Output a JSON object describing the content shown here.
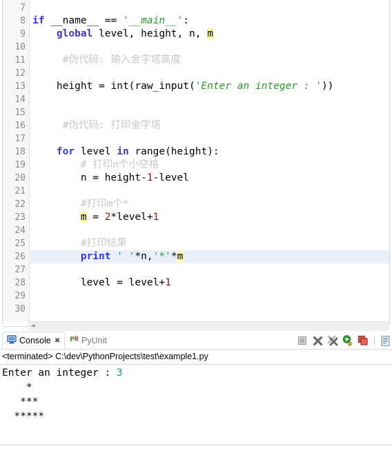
{
  "editor": {
    "name": "python-code-editor",
    "first_line_number": 7,
    "last_line_number": 30,
    "current_line": 26,
    "occurrence_token": "m",
    "lines": [
      {
        "n": 7,
        "segments": []
      },
      {
        "n": 8,
        "segments": [
          {
            "t": "if ",
            "c": "kw"
          },
          {
            "t": "__name__ == ",
            "c": "plain"
          },
          {
            "t": "'__main__'",
            "c": "str"
          },
          {
            "t": ":",
            "c": "plain"
          }
        ]
      },
      {
        "n": 9,
        "segments": [
          {
            "t": "    ",
            "c": "plain"
          },
          {
            "t": "global",
            "c": "kw"
          },
          {
            "t": " level, height, n, ",
            "c": "plain"
          },
          {
            "t": "m",
            "c": "occ"
          }
        ]
      },
      {
        "n": 10,
        "segments": []
      },
      {
        "n": 11,
        "segments": [
          {
            "t": "     ",
            "c": "plain"
          },
          {
            "t": "#伪代码: 输入金字塔高度",
            "c": "cmt"
          }
        ]
      },
      {
        "n": 12,
        "segments": []
      },
      {
        "n": 13,
        "segments": [
          {
            "t": "    height = int(raw_input(",
            "c": "plain"
          },
          {
            "t": "'Enter an integer : '",
            "c": "str"
          },
          {
            "t": "))",
            "c": "plain"
          }
        ]
      },
      {
        "n": 14,
        "segments": []
      },
      {
        "n": 15,
        "segments": []
      },
      {
        "n": 16,
        "segments": [
          {
            "t": "     ",
            "c": "plain"
          },
          {
            "t": "#伪代码: 打印金字塔",
            "c": "cmt"
          }
        ]
      },
      {
        "n": 17,
        "segments": []
      },
      {
        "n": 18,
        "segments": [
          {
            "t": "    ",
            "c": "plain"
          },
          {
            "t": "for",
            "c": "kw"
          },
          {
            "t": " level ",
            "c": "plain"
          },
          {
            "t": "in",
            "c": "kw"
          },
          {
            "t": " range(height):",
            "c": "plain"
          }
        ]
      },
      {
        "n": 19,
        "segments": [
          {
            "t": "        ",
            "c": "plain"
          },
          {
            "t": "# 打印n个小空格",
            "c": "cmt"
          }
        ]
      },
      {
        "n": 20,
        "segments": [
          {
            "t": "        n = height-",
            "c": "plain"
          },
          {
            "t": "1",
            "c": "num"
          },
          {
            "t": "-level",
            "c": "plain"
          }
        ]
      },
      {
        "n": 21,
        "segments": []
      },
      {
        "n": 22,
        "segments": [
          {
            "t": "        ",
            "c": "plain"
          },
          {
            "t": "#打印m个*",
            "c": "cmt"
          }
        ]
      },
      {
        "n": 23,
        "segments": [
          {
            "t": "        ",
            "c": "plain"
          },
          {
            "t": "m",
            "c": "occ"
          },
          {
            "t": " = ",
            "c": "plain"
          },
          {
            "t": "2",
            "c": "num"
          },
          {
            "t": "*level+",
            "c": "plain"
          },
          {
            "t": "1",
            "c": "num"
          }
        ]
      },
      {
        "n": 24,
        "segments": []
      },
      {
        "n": 25,
        "segments": [
          {
            "t": "        ",
            "c": "plain"
          },
          {
            "t": "#打印结果",
            "c": "cmt"
          }
        ]
      },
      {
        "n": 26,
        "segments": [
          {
            "t": "        ",
            "c": "plain"
          },
          {
            "t": "print",
            "c": "kw"
          },
          {
            "t": " ",
            "c": "plain"
          },
          {
            "t": "' '",
            "c": "strp"
          },
          {
            "t": "*n,",
            "c": "plain"
          },
          {
            "t": "'*'",
            "c": "strp"
          },
          {
            "t": "*",
            "c": "plain"
          },
          {
            "t": "m",
            "c": "occ"
          }
        ]
      },
      {
        "n": 27,
        "segments": []
      },
      {
        "n": 28,
        "segments": [
          {
            "t": "        level = level+",
            "c": "plain"
          },
          {
            "t": "1",
            "c": "num"
          }
        ]
      },
      {
        "n": 29,
        "segments": []
      },
      {
        "n": 30,
        "segments": []
      }
    ],
    "hscroll_left_arrow": "◄"
  },
  "console": {
    "tabs": [
      {
        "label": "Console",
        "icon": "console-monitor-icon",
        "active": true,
        "closeable": true
      },
      {
        "label": "PyUnit",
        "icon": "pyunit-icon",
        "active": false,
        "closeable": false
      }
    ],
    "close_glyph": "✖",
    "toolbar": [
      {
        "name": "terminate-button",
        "icon": "stop-square-icon"
      },
      {
        "name": "remove-launch-button",
        "icon": "remove-x-icon"
      },
      {
        "name": "remove-all-terminated-button",
        "icon": "remove-all-x-icon"
      },
      {
        "name": "display-selected-console-button",
        "icon": "display-console-icon"
      },
      {
        "name": "pin-console-button",
        "icon": "pin-console-icon"
      },
      {
        "name": "open-console-button",
        "icon": "open-console-icon"
      }
    ],
    "status_prefix": "<terminated>",
    "launch_path": "C:\\dev\\PythonProjects\\test\\example1.py",
    "output": [
      {
        "prompt": "Enter an integer : ",
        "input": "3"
      },
      {
        "text": "    *"
      },
      {
        "text": "   ***"
      },
      {
        "text": "  *****"
      }
    ]
  },
  "colors": {
    "keyword": "#3a34d2",
    "string": "#2a9c2a",
    "comment": "#c8c8c8",
    "number": "#8f1414",
    "occurrence_highlight": "#ffff99",
    "current_line_highlight": "#eaf0fb",
    "gutter_bg": "#f7f7f7",
    "console_input": "#11a36b"
  }
}
